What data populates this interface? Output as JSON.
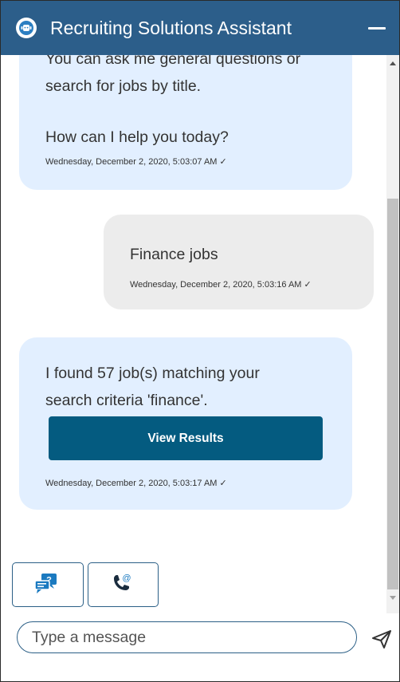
{
  "header": {
    "title": "Recruiting Solutions Assistant",
    "logo_icon": "headset-bot-icon",
    "minimize_icon": "minimize-icon"
  },
  "messages": [
    {
      "sender": "bot",
      "lines": [
        "You can ask me general questions or",
        "search for jobs by title.",
        "",
        "How can I help you today?"
      ],
      "timestamp": "Wednesday, December 2, 2020, 5:03:07 AM ✓"
    },
    {
      "sender": "user",
      "lines": [
        "Finance jobs"
      ],
      "timestamp": "Wednesday, December 2, 2020, 5:03:16 AM ✓"
    },
    {
      "sender": "bot",
      "lines": [
        "I found 57 job(s) matching your",
        "search criteria 'finance'."
      ],
      "button_label": "View Results",
      "timestamp": "Wednesday, December 2, 2020, 5:03:17 AM ✓"
    }
  ],
  "quick_actions": [
    {
      "icon": "faq-chat-icon"
    },
    {
      "icon": "phone-contact-icon"
    }
  ],
  "composer": {
    "placeholder": "Type a message",
    "value": "",
    "send_icon": "send-icon"
  },
  "colors": {
    "header": "#2c5e8a",
    "bot_bubble": "#e2efff",
    "user_bubble": "#ececec",
    "button": "#045b80",
    "accent": "#1b7ac0"
  }
}
